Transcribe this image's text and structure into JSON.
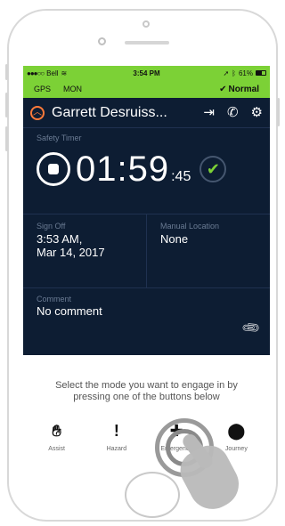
{
  "status_bar": {
    "carrier": "Bell",
    "time": "3:54 PM",
    "battery": "61%"
  },
  "gps_bar": {
    "gps_label": "GPS",
    "mon_label": "MON",
    "mode": "Normal"
  },
  "header": {
    "title": "Garrett Desruiss...",
    "alert_icon": "chevron-up-icon",
    "icons": [
      "logout-icon",
      "call-icon",
      "gear-icon"
    ]
  },
  "safety_timer": {
    "label": "Safety Timer",
    "time_main": "01:59",
    "time_seconds": ":45"
  },
  "sign_off": {
    "label": "Sign Off",
    "value": "3:53 AM,\nMar 14, 2017"
  },
  "manual_location": {
    "label": "Manual Location",
    "value": "None"
  },
  "comment": {
    "label": "Comment",
    "value": "No comment"
  },
  "instructions": "Select the mode you want to engage in by pressing one of the buttons below",
  "modes": [
    {
      "label": "Assist",
      "icon": "hand-icon"
    },
    {
      "label": "Hazard",
      "icon": "exclamation-icon"
    },
    {
      "label": "Emergency",
      "icon": "plus-icon"
    },
    {
      "label": "Journey",
      "icon": "location-pin-icon"
    }
  ],
  "colors": {
    "accent_green": "#7cd136",
    "panel_dark": "#0d1d33",
    "alert_orange": "#ff7a3a"
  }
}
